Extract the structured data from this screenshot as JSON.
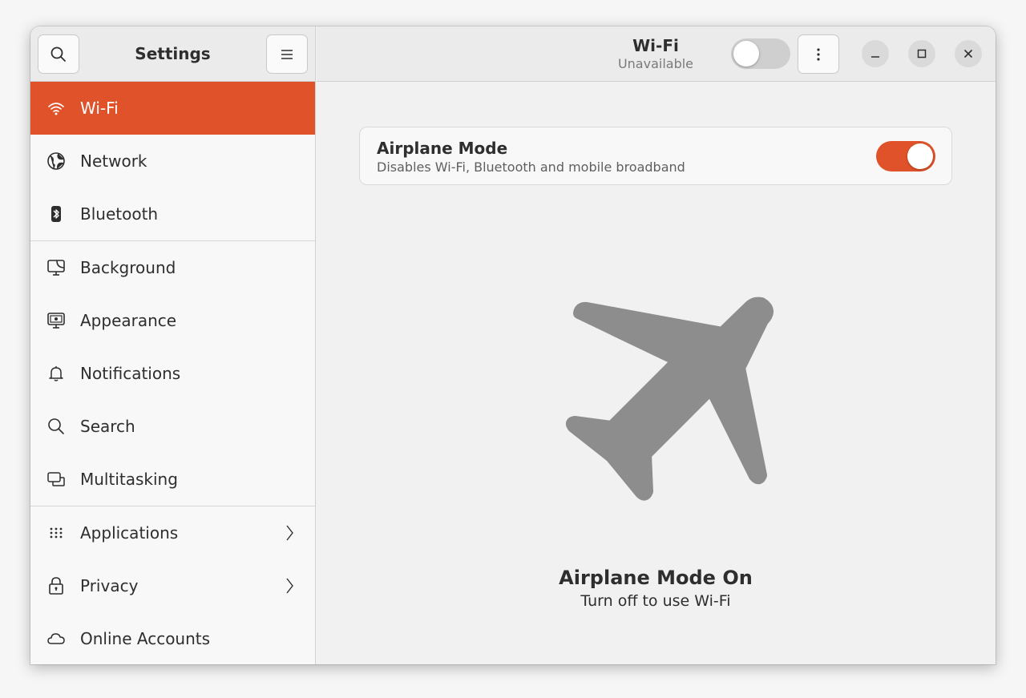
{
  "sidebar": {
    "title": "Settings",
    "items": [
      {
        "label": "Wi-Fi",
        "icon": "wifi-icon",
        "active": true
      },
      {
        "label": "Network",
        "icon": "globe-icon"
      },
      {
        "label": "Bluetooth",
        "icon": "bluetooth-icon"
      },
      {
        "label": "Background",
        "icon": "monitor-icon"
      },
      {
        "label": "Appearance",
        "icon": "appearance-icon"
      },
      {
        "label": "Notifications",
        "icon": "bell-icon"
      },
      {
        "label": "Search",
        "icon": "search-icon"
      },
      {
        "label": "Multitasking",
        "icon": "multitasking-icon"
      },
      {
        "label": "Applications",
        "icon": "grid-icon",
        "chevron": true
      },
      {
        "label": "Privacy",
        "icon": "lock-icon",
        "chevron": true
      },
      {
        "label": "Online Accounts",
        "icon": "cloud-icon"
      }
    ]
  },
  "header": {
    "title": "Wi-Fi",
    "subtitle": "Unavailable",
    "wifi_switch_on": false
  },
  "airplane": {
    "title": "Airplane Mode",
    "description": "Disables Wi-Fi, Bluetooth and mobile broadband",
    "switch_on": true
  },
  "empty_state": {
    "icon": "airplane-icon",
    "title": "Airplane Mode On",
    "subtitle": "Turn off to use Wi-Fi"
  },
  "colors": {
    "accent": "#e0532a",
    "switch_off": "#cfcfcf",
    "icon_gray": "#8d8d8d"
  }
}
